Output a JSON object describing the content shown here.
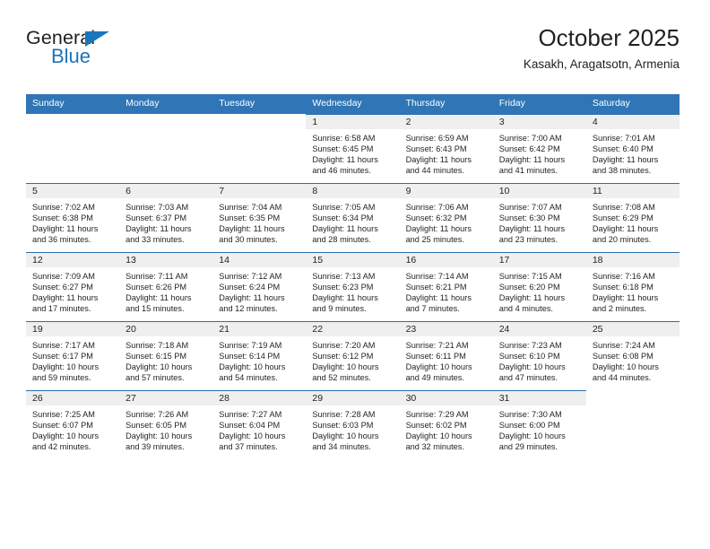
{
  "logo": {
    "word1": "General",
    "word2": "Blue",
    "triangle_color": "#1b75bb"
  },
  "header": {
    "title": "October 2025",
    "subtitle": "Kasakh, Aragatsotn, Armenia"
  },
  "theme": {
    "header_blue": "#3075b5",
    "rule_blue": "#2c6fad",
    "band_grey": "#efefef",
    "text": "#231f20"
  },
  "weekdays": [
    "Sunday",
    "Monday",
    "Tuesday",
    "Wednesday",
    "Thursday",
    "Friday",
    "Saturday"
  ],
  "weeks": [
    [
      {
        "day": "",
        "sunrise": "",
        "sunset": "",
        "daylight1": "",
        "daylight2": "",
        "empty": true
      },
      {
        "day": "",
        "sunrise": "",
        "sunset": "",
        "daylight1": "",
        "daylight2": "",
        "empty": true
      },
      {
        "day": "",
        "sunrise": "",
        "sunset": "",
        "daylight1": "",
        "daylight2": "",
        "empty": true
      },
      {
        "day": "1",
        "sunrise": "Sunrise: 6:58 AM",
        "sunset": "Sunset: 6:45 PM",
        "daylight1": "Daylight: 11 hours",
        "daylight2": "and 46 minutes.",
        "empty": false
      },
      {
        "day": "2",
        "sunrise": "Sunrise: 6:59 AM",
        "sunset": "Sunset: 6:43 PM",
        "daylight1": "Daylight: 11 hours",
        "daylight2": "and 44 minutes.",
        "empty": false
      },
      {
        "day": "3",
        "sunrise": "Sunrise: 7:00 AM",
        "sunset": "Sunset: 6:42 PM",
        "daylight1": "Daylight: 11 hours",
        "daylight2": "and 41 minutes.",
        "empty": false
      },
      {
        "day": "4",
        "sunrise": "Sunrise: 7:01 AM",
        "sunset": "Sunset: 6:40 PM",
        "daylight1": "Daylight: 11 hours",
        "daylight2": "and 38 minutes.",
        "empty": false
      }
    ],
    [
      {
        "day": "5",
        "sunrise": "Sunrise: 7:02 AM",
        "sunset": "Sunset: 6:38 PM",
        "daylight1": "Daylight: 11 hours",
        "daylight2": "and 36 minutes.",
        "empty": false
      },
      {
        "day": "6",
        "sunrise": "Sunrise: 7:03 AM",
        "sunset": "Sunset: 6:37 PM",
        "daylight1": "Daylight: 11 hours",
        "daylight2": "and 33 minutes.",
        "empty": false
      },
      {
        "day": "7",
        "sunrise": "Sunrise: 7:04 AM",
        "sunset": "Sunset: 6:35 PM",
        "daylight1": "Daylight: 11 hours",
        "daylight2": "and 30 minutes.",
        "empty": false
      },
      {
        "day": "8",
        "sunrise": "Sunrise: 7:05 AM",
        "sunset": "Sunset: 6:34 PM",
        "daylight1": "Daylight: 11 hours",
        "daylight2": "and 28 minutes.",
        "empty": false
      },
      {
        "day": "9",
        "sunrise": "Sunrise: 7:06 AM",
        "sunset": "Sunset: 6:32 PM",
        "daylight1": "Daylight: 11 hours",
        "daylight2": "and 25 minutes.",
        "empty": false
      },
      {
        "day": "10",
        "sunrise": "Sunrise: 7:07 AM",
        "sunset": "Sunset: 6:30 PM",
        "daylight1": "Daylight: 11 hours",
        "daylight2": "and 23 minutes.",
        "empty": false
      },
      {
        "day": "11",
        "sunrise": "Sunrise: 7:08 AM",
        "sunset": "Sunset: 6:29 PM",
        "daylight1": "Daylight: 11 hours",
        "daylight2": "and 20 minutes.",
        "empty": false
      }
    ],
    [
      {
        "day": "12",
        "sunrise": "Sunrise: 7:09 AM",
        "sunset": "Sunset: 6:27 PM",
        "daylight1": "Daylight: 11 hours",
        "daylight2": "and 17 minutes.",
        "empty": false
      },
      {
        "day": "13",
        "sunrise": "Sunrise: 7:11 AM",
        "sunset": "Sunset: 6:26 PM",
        "daylight1": "Daylight: 11 hours",
        "daylight2": "and 15 minutes.",
        "empty": false
      },
      {
        "day": "14",
        "sunrise": "Sunrise: 7:12 AM",
        "sunset": "Sunset: 6:24 PM",
        "daylight1": "Daylight: 11 hours",
        "daylight2": "and 12 minutes.",
        "empty": false
      },
      {
        "day": "15",
        "sunrise": "Sunrise: 7:13 AM",
        "sunset": "Sunset: 6:23 PM",
        "daylight1": "Daylight: 11 hours",
        "daylight2": "and 9 minutes.",
        "empty": false
      },
      {
        "day": "16",
        "sunrise": "Sunrise: 7:14 AM",
        "sunset": "Sunset: 6:21 PM",
        "daylight1": "Daylight: 11 hours",
        "daylight2": "and 7 minutes.",
        "empty": false
      },
      {
        "day": "17",
        "sunrise": "Sunrise: 7:15 AM",
        "sunset": "Sunset: 6:20 PM",
        "daylight1": "Daylight: 11 hours",
        "daylight2": "and 4 minutes.",
        "empty": false
      },
      {
        "day": "18",
        "sunrise": "Sunrise: 7:16 AM",
        "sunset": "Sunset: 6:18 PM",
        "daylight1": "Daylight: 11 hours",
        "daylight2": "and 2 minutes.",
        "empty": false
      }
    ],
    [
      {
        "day": "19",
        "sunrise": "Sunrise: 7:17 AM",
        "sunset": "Sunset: 6:17 PM",
        "daylight1": "Daylight: 10 hours",
        "daylight2": "and 59 minutes.",
        "empty": false
      },
      {
        "day": "20",
        "sunrise": "Sunrise: 7:18 AM",
        "sunset": "Sunset: 6:15 PM",
        "daylight1": "Daylight: 10 hours",
        "daylight2": "and 57 minutes.",
        "empty": false
      },
      {
        "day": "21",
        "sunrise": "Sunrise: 7:19 AM",
        "sunset": "Sunset: 6:14 PM",
        "daylight1": "Daylight: 10 hours",
        "daylight2": "and 54 minutes.",
        "empty": false
      },
      {
        "day": "22",
        "sunrise": "Sunrise: 7:20 AM",
        "sunset": "Sunset: 6:12 PM",
        "daylight1": "Daylight: 10 hours",
        "daylight2": "and 52 minutes.",
        "empty": false
      },
      {
        "day": "23",
        "sunrise": "Sunrise: 7:21 AM",
        "sunset": "Sunset: 6:11 PM",
        "daylight1": "Daylight: 10 hours",
        "daylight2": "and 49 minutes.",
        "empty": false
      },
      {
        "day": "24",
        "sunrise": "Sunrise: 7:23 AM",
        "sunset": "Sunset: 6:10 PM",
        "daylight1": "Daylight: 10 hours",
        "daylight2": "and 47 minutes.",
        "empty": false
      },
      {
        "day": "25",
        "sunrise": "Sunrise: 7:24 AM",
        "sunset": "Sunset: 6:08 PM",
        "daylight1": "Daylight: 10 hours",
        "daylight2": "and 44 minutes.",
        "empty": false
      }
    ],
    [
      {
        "day": "26",
        "sunrise": "Sunrise: 7:25 AM",
        "sunset": "Sunset: 6:07 PM",
        "daylight1": "Daylight: 10 hours",
        "daylight2": "and 42 minutes.",
        "empty": false
      },
      {
        "day": "27",
        "sunrise": "Sunrise: 7:26 AM",
        "sunset": "Sunset: 6:05 PM",
        "daylight1": "Daylight: 10 hours",
        "daylight2": "and 39 minutes.",
        "empty": false
      },
      {
        "day": "28",
        "sunrise": "Sunrise: 7:27 AM",
        "sunset": "Sunset: 6:04 PM",
        "daylight1": "Daylight: 10 hours",
        "daylight2": "and 37 minutes.",
        "empty": false
      },
      {
        "day": "29",
        "sunrise": "Sunrise: 7:28 AM",
        "sunset": "Sunset: 6:03 PM",
        "daylight1": "Daylight: 10 hours",
        "daylight2": "and 34 minutes.",
        "empty": false
      },
      {
        "day": "30",
        "sunrise": "Sunrise: 7:29 AM",
        "sunset": "Sunset: 6:02 PM",
        "daylight1": "Daylight: 10 hours",
        "daylight2": "and 32 minutes.",
        "empty": false
      },
      {
        "day": "31",
        "sunrise": "Sunrise: 7:30 AM",
        "sunset": "Sunset: 6:00 PM",
        "daylight1": "Daylight: 10 hours",
        "daylight2": "and 29 minutes.",
        "empty": false
      },
      {
        "day": "",
        "sunrise": "",
        "sunset": "",
        "daylight1": "",
        "daylight2": "",
        "empty": true
      }
    ]
  ]
}
